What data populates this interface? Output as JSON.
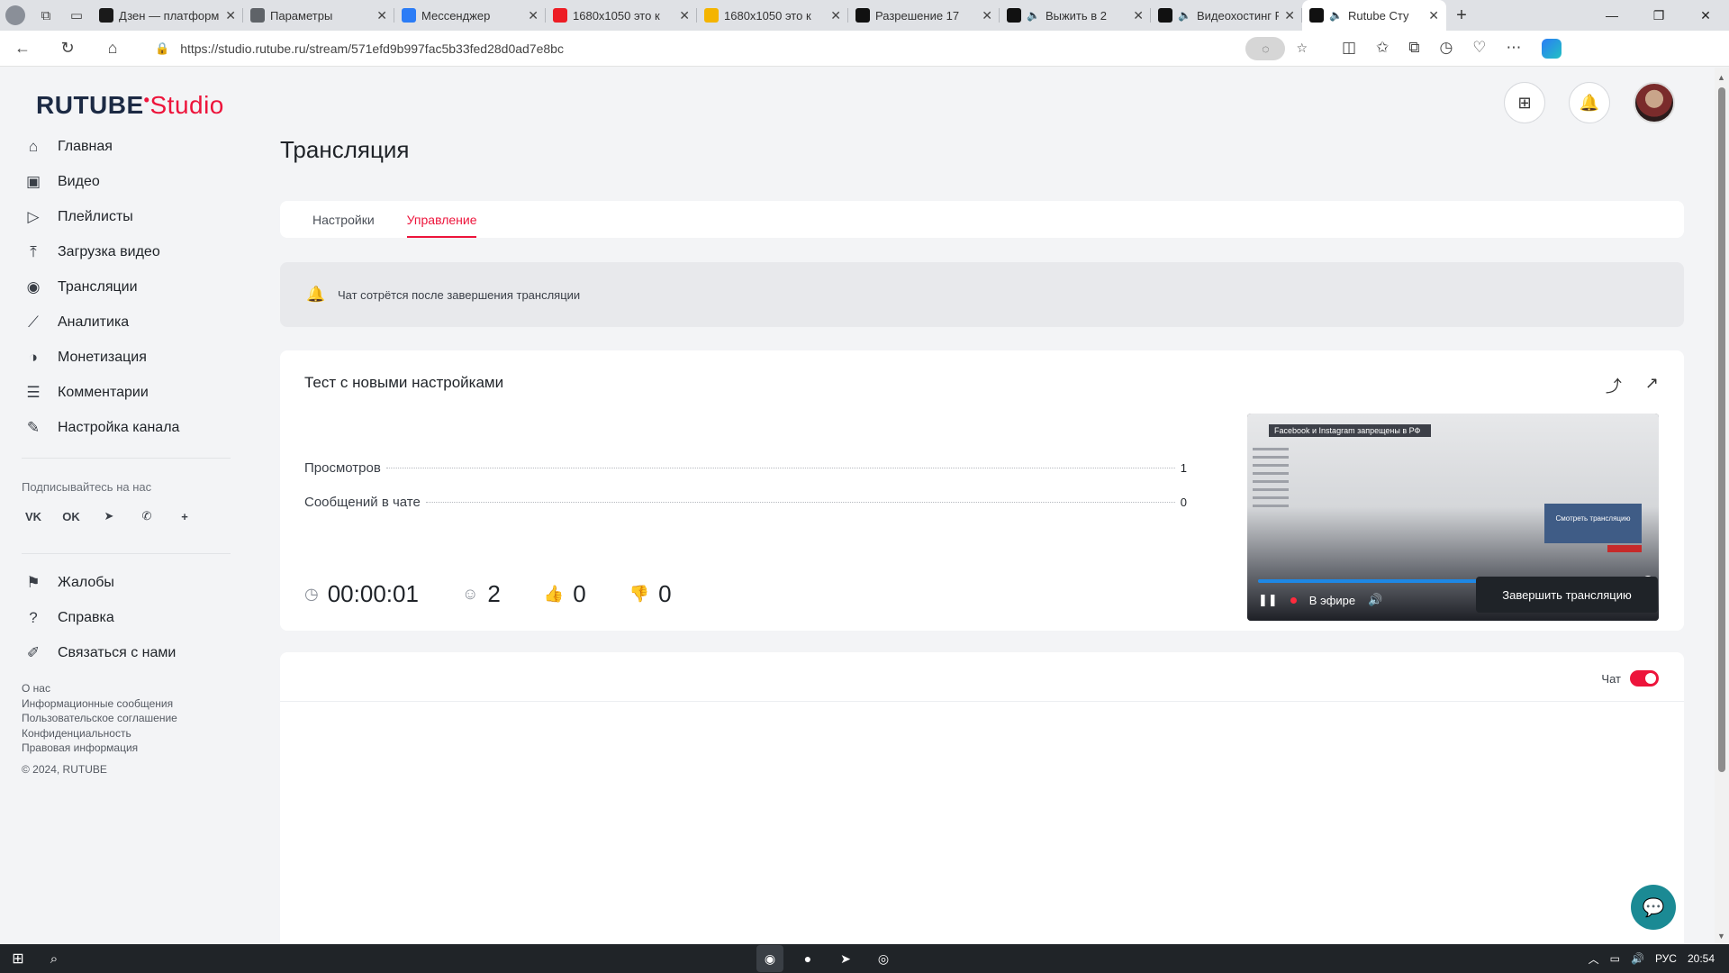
{
  "browser": {
    "tabs": [
      {
        "title": "Дзен — платформ",
        "favicon_color": "#1a1a1a"
      },
      {
        "title": "Параметры",
        "favicon_color": "#5f6368"
      },
      {
        "title": "Мессенджер",
        "favicon_color": "#2b7cf6"
      },
      {
        "title": "1680x1050 это к",
        "favicon_color": "#ed1c24"
      },
      {
        "title": "1680x1050 это к",
        "favicon_color": "#f4b400"
      },
      {
        "title": "Разрешение 17",
        "favicon_color": "#111111"
      },
      {
        "title": "Выжить в 2",
        "favicon_color": "#111111"
      },
      {
        "title": "Видеохостинг R",
        "favicon_color": "#111111"
      },
      {
        "title": "Rutube Сту",
        "favicon_color": "#111111"
      }
    ],
    "url": "https://studio.rutube.ru/stream/571efd9b997fac5b33fed28d0ad7e8bc"
  },
  "logo": {
    "rutube": "RUTUBE",
    "studio": "Studio"
  },
  "sidebar": {
    "items": [
      {
        "label": "Главная",
        "icon": "home-icon"
      },
      {
        "label": "Видео",
        "icon": "video-icon"
      },
      {
        "label": "Плейлисты",
        "icon": "playlist-icon"
      },
      {
        "label": "Загрузка видео",
        "icon": "upload-icon"
      },
      {
        "label": "Трансляции",
        "icon": "broadcast-icon"
      },
      {
        "label": "Аналитика",
        "icon": "analytics-icon"
      },
      {
        "label": "Монетизация",
        "icon": "monetization-icon"
      },
      {
        "label": "Комментарии",
        "icon": "comments-icon"
      },
      {
        "label": "Настройка канала",
        "icon": "channel-settings-icon"
      }
    ],
    "subscribe_label": "Подписывайтесь на нас",
    "socials": [
      "vk-icon",
      "odnoklassniki-icon",
      "telegram-icon",
      "viber-icon",
      "plus-icon"
    ],
    "secondary": [
      {
        "label": "Жалобы",
        "icon": "flag-icon"
      },
      {
        "label": "Справка",
        "icon": "help-icon"
      },
      {
        "label": "Связаться с нами",
        "icon": "contact-icon"
      }
    ],
    "footer_links": [
      "О нас",
      "Информационные сообщения",
      "Пользовательское соглашение",
      "Конфиденциальность",
      "Правовая информация"
    ],
    "copyright": "© 2024, RUTUBE"
  },
  "page": {
    "title": "Трансляция",
    "tabs": [
      {
        "label": "Настройки",
        "active": false
      },
      {
        "label": "Управление",
        "active": true
      }
    ],
    "notice": "Чат сотрётся после завершения трансляции",
    "stream": {
      "name": "Тест с новыми настройками",
      "views_label": "Просмотров",
      "views_value": "1",
      "messages_label": "Сообщений в чате",
      "messages_value": "0",
      "duration": "00:00:01",
      "viewers": "2",
      "likes": "0",
      "dislikes": "0",
      "end_button": "Завершить трансляцию",
      "player": {
        "banner": "Facebook и Instagram запрещены в РФ",
        "live_label": "В эфире",
        "progress": 1.0,
        "inner_box": "Смотреть трансляцию"
      }
    },
    "chat": {
      "label": "Чат",
      "enabled": true
    }
  },
  "taskbar": {
    "lang": "РУС",
    "time": "20:54"
  },
  "colors": {
    "accent": "#ed143b",
    "dark": "#1f2328",
    "support": "#1b8a94"
  }
}
